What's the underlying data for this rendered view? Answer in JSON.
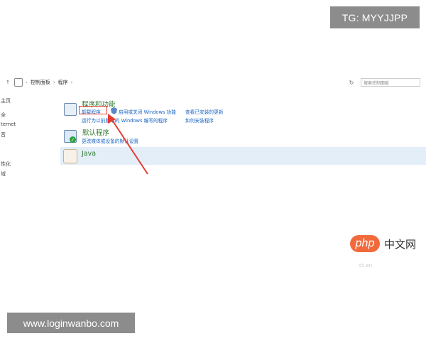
{
  "watermarks": {
    "top": "TG: MYYJJPP",
    "bottom": "www.loginwanbo.com",
    "php_logo": "php",
    "php_cn": "中文网",
    "faint": "s5.en"
  },
  "address_bar": {
    "back_icon": "↑",
    "crumbs": [
      "控制面板",
      "程序"
    ],
    "refresh": "↻",
    "search_placeholder": "搜索控制面板"
  },
  "left_nav": [
    "主页",
    "全",
    "ternet",
    "音",
    "性化",
    "域"
  ],
  "sections": {
    "programs": {
      "title": "程序和功能",
      "links": {
        "uninstall": "卸载程序",
        "win_features": "启用或关闭 Windows 功能",
        "view_updates": "查看已安装的更新",
        "run_old": "运行为以前版本的 Windows 编写的程序",
        "how_to": "如何安装程序"
      }
    },
    "default_programs": {
      "title": "默认程序",
      "link": "更改媒体或设备的默认设置"
    },
    "java": {
      "title": "Java"
    }
  },
  "annotation_color": "#e53a2f"
}
